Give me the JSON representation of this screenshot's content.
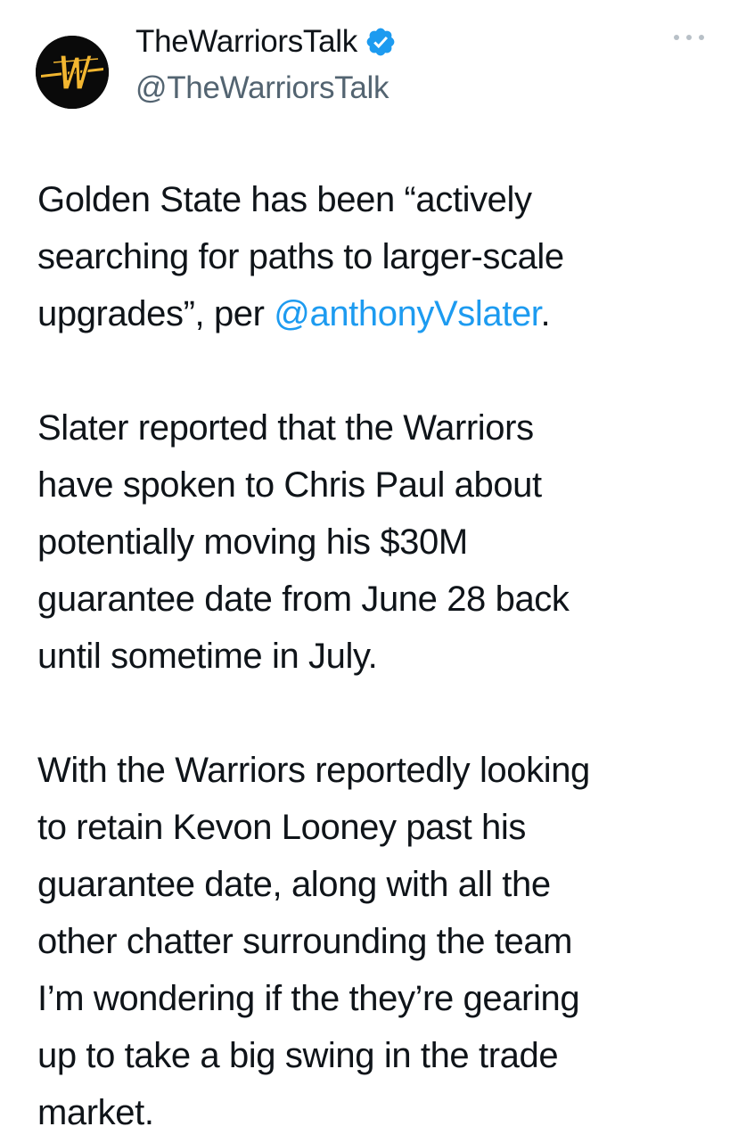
{
  "author": {
    "display_name": "TheWarriorsTalk",
    "handle": "@TheWarriorsTalk",
    "verified": true,
    "avatar_icon": "warriors-w-logo",
    "avatar_bg": "#0a0a0a",
    "avatar_accent": "#f2b630"
  },
  "menu": {
    "icon": "more-dots-icon"
  },
  "colors": {
    "text": "#0f1419",
    "secondary": "#536471",
    "link": "#1d9bf0",
    "verified": "#1d9bf0"
  },
  "tweet": {
    "paragraph1": {
      "line1": "Golden State has been “actively",
      "line2": "searching for paths to larger-scale",
      "line3_before": "upgrades”, per ",
      "line3_mention": "@anthonyVslater",
      "line3_after": "."
    },
    "paragraph2": {
      "lines": [
        "Slater reported that the Warriors",
        "have spoken to Chris Paul about",
        "potentially moving his $30M",
        "guarantee date from June 28 back",
        "until sometime in July."
      ]
    },
    "paragraph3": {
      "lines": [
        "With the Warriors reportedly looking",
        "to retain Kevon Looney past his",
        "guarantee date, along with all the",
        "other chatter surrounding the team",
        "I’m wondering if the they’re gearing",
        "up to take a big swing in the trade",
        "market."
      ]
    }
  }
}
